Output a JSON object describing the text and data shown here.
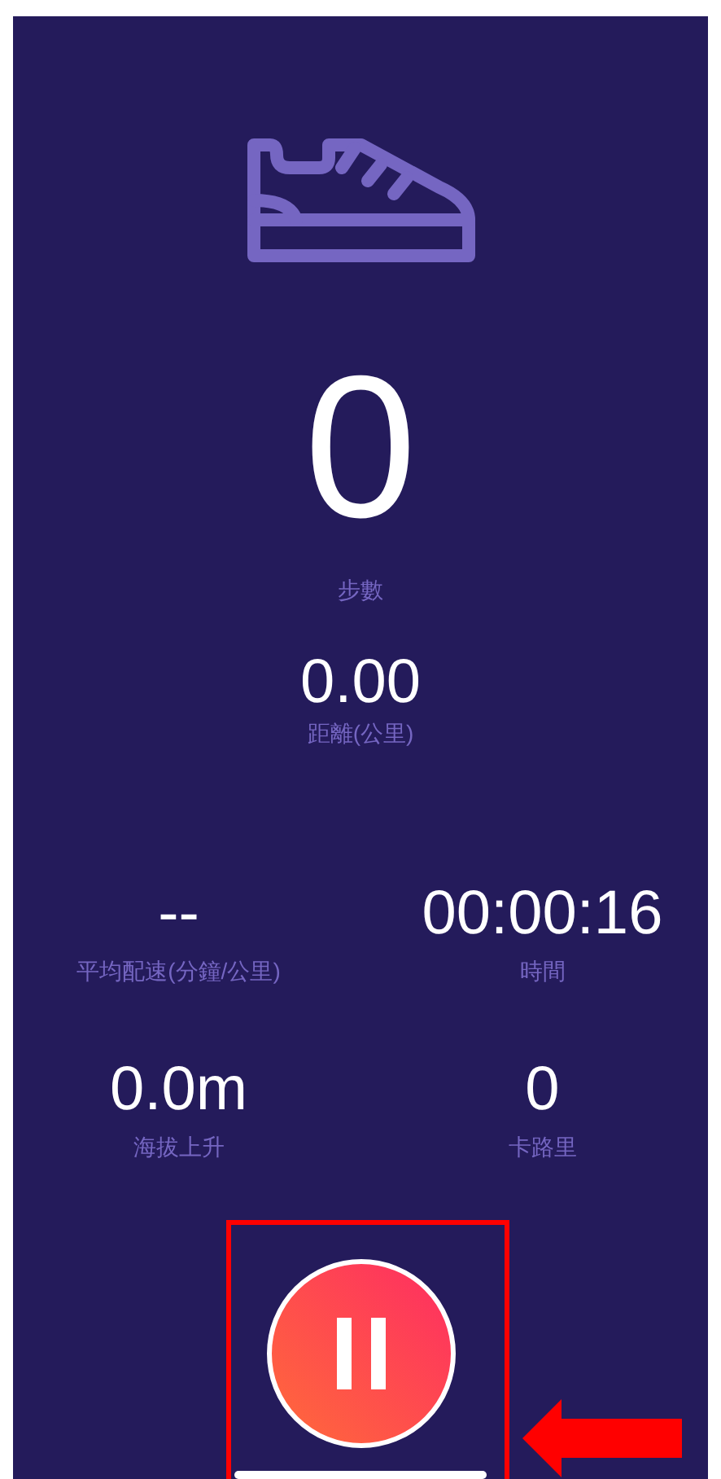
{
  "steps": {
    "value": "0",
    "label": "步數"
  },
  "distance": {
    "value": "0.00",
    "label": "距離(公里)"
  },
  "stat_rows": [
    {
      "cells": [
        {
          "value": "--",
          "label": "平均配速(分鐘/公里)"
        },
        {
          "value": "00:00:16",
          "label": "時間"
        }
      ]
    },
    {
      "cells": [
        {
          "value": "0.0m",
          "label": "海拔上升"
        },
        {
          "value": "0",
          "label": "卡路里"
        }
      ]
    }
  ]
}
